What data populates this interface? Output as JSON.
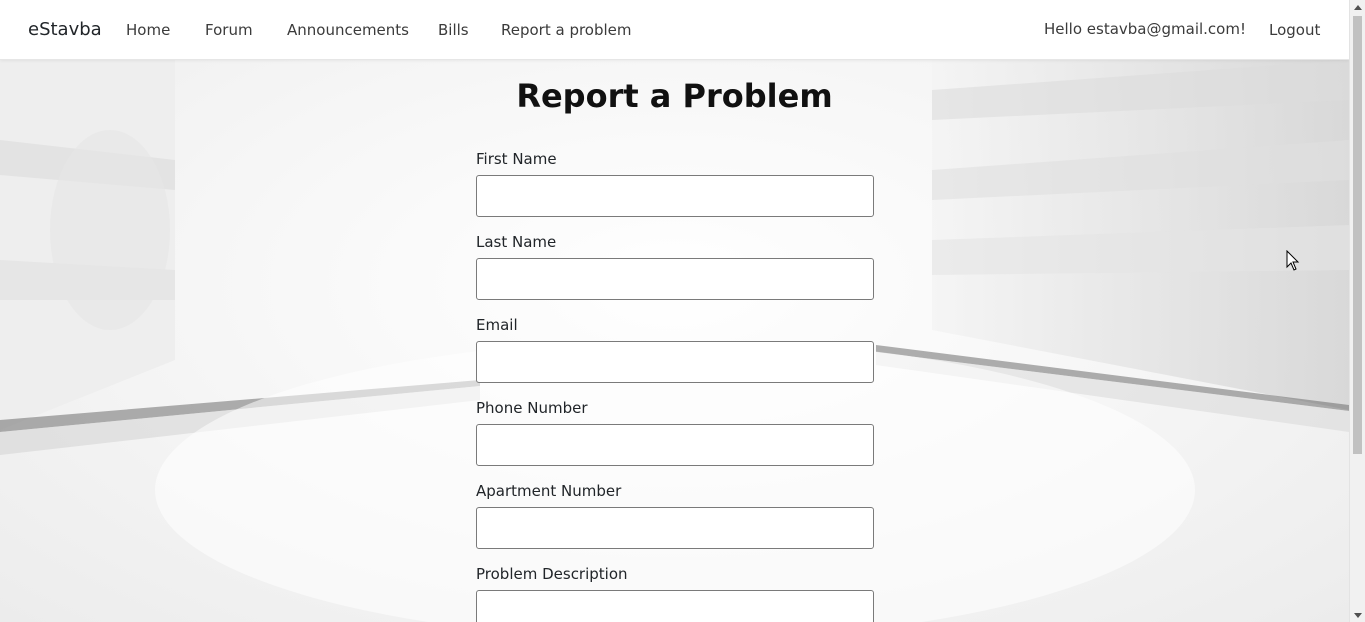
{
  "navbar": {
    "brand": "eStavba",
    "links": [
      {
        "label": "Home"
      },
      {
        "label": "Forum"
      },
      {
        "label": "Announcements"
      },
      {
        "label": "Bills"
      },
      {
        "label": "Report a problem"
      }
    ],
    "greeting": "Hello estavba@gmail.com!",
    "logout": "Logout"
  },
  "page": {
    "title": "Report a Problem"
  },
  "form": {
    "fields": [
      {
        "label": "First Name",
        "value": "",
        "placeholder": ""
      },
      {
        "label": "Last Name",
        "value": "",
        "placeholder": ""
      },
      {
        "label": "Email",
        "value": "",
        "placeholder": ""
      },
      {
        "label": "Phone Number",
        "value": "",
        "placeholder": ""
      },
      {
        "label": "Apartment Number",
        "value": "",
        "placeholder": ""
      },
      {
        "label": "Problem Description",
        "value": "",
        "placeholder": ""
      }
    ]
  },
  "icons": {
    "scroll_up": "chevron-up-icon",
    "scroll_down": "chevron-down-icon",
    "cursor": "mouse-pointer-icon"
  },
  "colors": {
    "navbar_bg": "#ffffff",
    "text": "#212529",
    "field_border": "#7a7a7a"
  }
}
